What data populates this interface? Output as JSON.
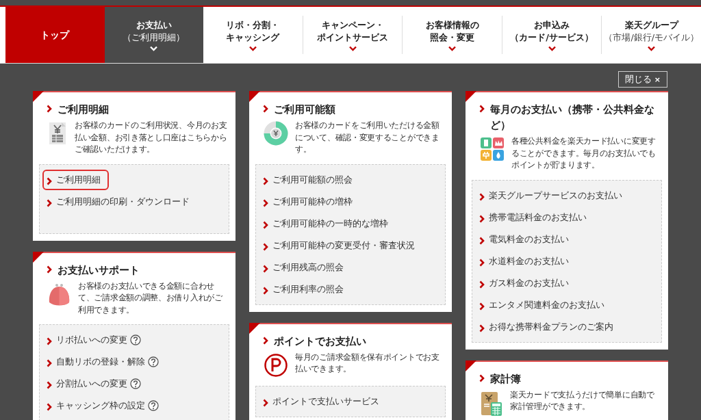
{
  "nav": {
    "tabs": [
      {
        "kind": "home",
        "lines": [
          "トップ"
        ],
        "selected": false
      },
      {
        "kind": "menu",
        "lines": [
          "お支払い"
        ],
        "subtitle": "（ご利用明細）",
        "selected": true
      },
      {
        "kind": "menu",
        "lines": [
          "リボ・分割・",
          "キャッシング"
        ],
        "selected": false
      },
      {
        "kind": "menu",
        "lines": [
          "キャンペーン・",
          "ポイントサービス"
        ],
        "selected": false
      },
      {
        "kind": "menu",
        "lines": [
          "お客様情報の",
          "照会・変更"
        ],
        "selected": false
      },
      {
        "kind": "menu",
        "lines": [
          "お申込み",
          "（カード/サービス）"
        ],
        "selected": false
      },
      {
        "kind": "menu",
        "lines": [
          "楽天グループ"
        ],
        "subtitle": "（市場/銀行/モバイル）",
        "selected": false
      }
    ]
  },
  "close_button": {
    "label": "閉じる",
    "mark": "×"
  },
  "columns": [
    [
      {
        "kind": "statement",
        "title": "ご利用明細",
        "description": "お客様のカードのご利用状況、今月のお支払い金額、お引き落とし口座はこちらからご確認いただけます。",
        "links": [
          {
            "label": "ご利用明細",
            "highlighted": true
          },
          {
            "label": "ご利用明細の印刷・ダウンロード",
            "highlighted": false
          }
        ]
      },
      {
        "kind": "support",
        "title": "お支払いサポート",
        "description": "お客様のお支払いできる金額に合わせて、ご請求金額の調整、お借り入れがご利用できます。",
        "links": [
          {
            "label": "リボ払いへの変更",
            "help": true
          },
          {
            "label": "自動リボの登録・解除",
            "help": true
          },
          {
            "label": "分割払いへの変更",
            "help": true
          },
          {
            "label": "キャッシング枠の設定",
            "help": true
          }
        ]
      }
    ],
    [
      {
        "kind": "limit",
        "title": "ご利用可能額",
        "description": "お客様のカードをご利用いただける金額について、確認・変更することができます。",
        "links": [
          {
            "label": "ご利用可能額の照会"
          },
          {
            "label": "ご利用可能枠の増枠"
          },
          {
            "label": "ご利用可能枠の一時的な増枠"
          },
          {
            "label": "ご利用可能枠の変更受付・審査状況"
          },
          {
            "label": "ご利用残高の照会"
          },
          {
            "label": "ご利用利率の照会"
          }
        ]
      },
      {
        "kind": "points",
        "title": "ポイントでお支払い",
        "description": "毎月のご請求金額を保有ポイントでお支払いできます。",
        "links": [
          {
            "label": "ポイントで支払いサービス"
          }
        ]
      }
    ],
    [
      {
        "kind": "utilities",
        "title": "毎月のお支払い（携帯・公共料金など）",
        "description": "各種公共料金を楽天カード払いに変更することができます。毎月のお支払いでもポイントが貯まります。",
        "links": [
          {
            "label": "楽天グループサービスのお支払い"
          },
          {
            "label": "携帯電話料金のお支払い"
          },
          {
            "label": "電気料金のお支払い"
          },
          {
            "label": "水道料金のお支払い"
          },
          {
            "label": "ガス料金のお支払い"
          },
          {
            "label": "エンタメ関連料金のお支払い"
          },
          {
            "label": "お得な携帯料金プランのご案内"
          }
        ]
      },
      {
        "kind": "household",
        "title": "家計簿",
        "description": "楽天カードで支払うだけで簡単に自動で家計管理ができます。"
      }
    ]
  ]
}
